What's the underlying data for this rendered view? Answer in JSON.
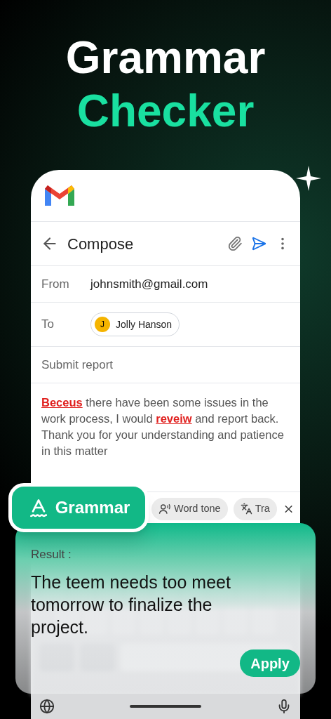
{
  "headline": [
    "Grammar",
    "Checker"
  ],
  "compose": {
    "title": "Compose",
    "fields": [
      {
        "label": "From",
        "value": "johnsmith@gmail.com",
        "kind": "text"
      },
      {
        "label": "To",
        "value": "Jolly Hanson",
        "initial": "J",
        "kind": "chip"
      }
    ],
    "subject": "Submit report",
    "body": [
      {
        "text": "Beceus",
        "error": true
      },
      {
        "text": " there have been some issues in the work process, I would ",
        "error": false
      },
      {
        "text": "reveiw",
        "error": true
      },
      {
        "text": " and report back. Thank you for your understanding and patience in this matter",
        "error": false
      }
    ]
  },
  "tools": [
    {
      "label": "Grammar",
      "selected": true,
      "kind": "grammar"
    },
    {
      "label": "Word tone",
      "selected": false,
      "kind": "tone"
    },
    {
      "label": "Tra",
      "selected": false,
      "kind": "translate"
    }
  ],
  "result": {
    "label": "Result :",
    "text": "The teem needs too meet tomorrow to finalize the project.",
    "button": "Apply"
  }
}
